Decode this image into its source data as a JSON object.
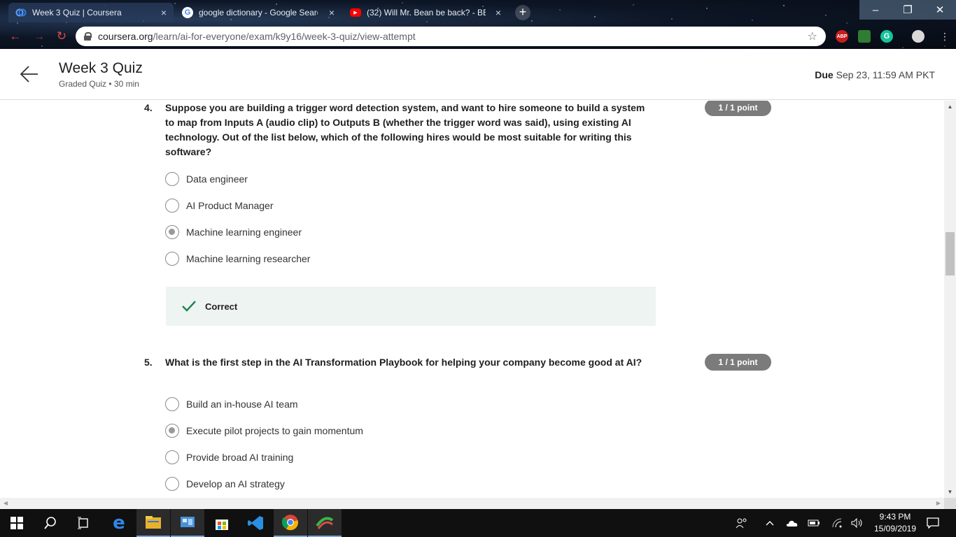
{
  "browser": {
    "tabs": [
      {
        "title": "Week 3 Quiz | Coursera",
        "close": "×",
        "favicon": "coursera-icon"
      },
      {
        "title": "google dictionary - Google Searc",
        "close": "×",
        "favicon": "google-icon"
      },
      {
        "title": "(32) Will Mr. Bean be back? - BB(",
        "close": "×",
        "favicon": "youtube-icon"
      }
    ],
    "new_tab": "+",
    "window_controls": {
      "minimize": "–",
      "maximize": "❐",
      "close": "✕"
    },
    "url_host": "coursera.org",
    "url_path": "/learn/ai-for-everyone/exam/k9y16/week-3-quiz/view-attempt",
    "extensions": [
      "ABP",
      "",
      "G",
      ""
    ]
  },
  "header": {
    "title": "Week 3 Quiz",
    "subtitle": "Graded Quiz • 30 min",
    "due_label": "Due",
    "due_value": "Sep 23, 11:59 AM PKT"
  },
  "questions": [
    {
      "number": "4.",
      "text": "Suppose you are building a trigger word detection system, and want to hire someone to build a system to map from Inputs A (audio clip) to Outputs B (whether the trigger word was said), using existing AI technology. Out of the list below, which of the following hires would be most suitable for writing this software?",
      "points": "1 / 1 point",
      "options": [
        {
          "label": "Data engineer",
          "selected": false
        },
        {
          "label": "AI Product Manager",
          "selected": false
        },
        {
          "label": "Machine learning engineer",
          "selected": true
        },
        {
          "label": "Machine learning researcher",
          "selected": false
        }
      ],
      "feedback": "Correct"
    },
    {
      "number": "5.",
      "text": "What is the first step in the AI Transformation Playbook for helping your company become good at AI?",
      "points": "1 / 1 point",
      "options": [
        {
          "label": "Build an in-house AI team",
          "selected": false
        },
        {
          "label": "Execute pilot projects to gain momentum",
          "selected": true
        },
        {
          "label": "Provide broad AI training",
          "selected": false
        },
        {
          "label": "Develop an AI strategy",
          "selected": false
        }
      ]
    }
  ],
  "taskbar": {
    "apps": [
      "windows-start",
      "search",
      "task-view",
      "edge",
      "file-explorer",
      "control-panel",
      "store",
      "vscode",
      "chrome",
      "app"
    ],
    "clock_time": "9:43 PM",
    "clock_date": "15/09/2019"
  },
  "colors": {
    "points_badge": "#7b7b7b",
    "correct_check": "#1f8354",
    "feedback_bg": "#eef4f1"
  }
}
